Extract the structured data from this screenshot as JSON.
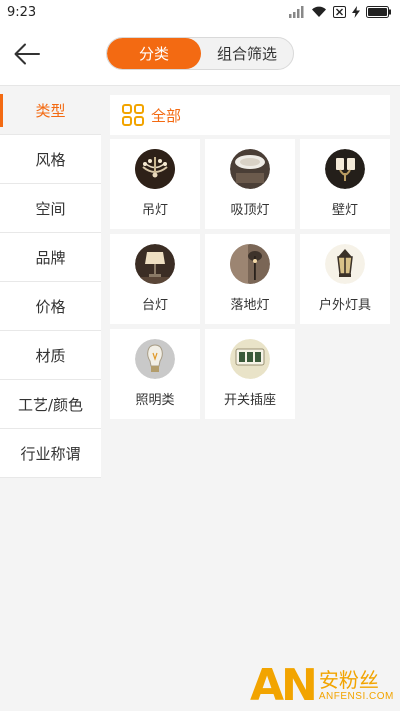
{
  "statusbar": {
    "time": "9:23"
  },
  "header": {
    "tabs": [
      {
        "label": "分类",
        "active": true
      },
      {
        "label": "组合筛选",
        "active": false
      }
    ]
  },
  "sidebar": {
    "items": [
      {
        "label": "类型",
        "active": true
      },
      {
        "label": "风格"
      },
      {
        "label": "空间"
      },
      {
        "label": "品牌"
      },
      {
        "label": "价格"
      },
      {
        "label": "材质"
      },
      {
        "label": "工艺/颜色"
      },
      {
        "label": "行业称谓"
      }
    ]
  },
  "content": {
    "all_label": "全部",
    "categories": [
      {
        "label": "吊灯",
        "icon": "chandelier-icon"
      },
      {
        "label": "吸顶灯",
        "icon": "ceiling-light-icon"
      },
      {
        "label": "壁灯",
        "icon": "wall-lamp-icon"
      },
      {
        "label": "台灯",
        "icon": "table-lamp-icon"
      },
      {
        "label": "落地灯",
        "icon": "floor-lamp-icon"
      },
      {
        "label": "户外灯具",
        "icon": "outdoor-lamp-icon"
      },
      {
        "label": "照明类",
        "icon": "bulb-icon"
      },
      {
        "label": "开关插座",
        "icon": "switch-socket-icon"
      }
    ]
  },
  "watermark": {
    "mark": "AN",
    "cn": "安粉丝",
    "en": "ANFENSI.COM"
  },
  "colors": {
    "accent": "#f36a12",
    "watermark": "#f2a400"
  }
}
